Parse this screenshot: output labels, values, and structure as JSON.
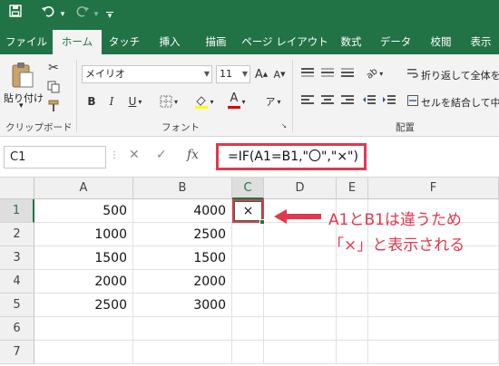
{
  "qat": {
    "redo_arrow": "▾",
    "customize": "▾"
  },
  "tabs": [
    "ファイル",
    "ホーム",
    "タッチ",
    "挿入",
    "描画",
    "ページ レイアウト",
    "数式",
    "データ",
    "校閲",
    "表示"
  ],
  "ribbon": {
    "clipboard": {
      "paste_label": "貼り付け",
      "paste_arrow": "▾",
      "group_label": "クリップボード"
    },
    "font": {
      "font_name": "メイリオ",
      "font_size": "11",
      "grow": "A",
      "shrink": "A",
      "bold": "B",
      "italic": "I",
      "underline": "U",
      "underline_arrow": "▾",
      "font_color": "A",
      "phonetic": "ア",
      "group_label": "フォント"
    },
    "alignment": {
      "wrap_text": "折り返して全体を",
      "merge_center": "セルを結合して中央",
      "group_label": "配置"
    }
  },
  "formula_bar": {
    "name_box": "C1",
    "cancel": "✕",
    "enter": "✓",
    "fx": "fx",
    "formula": "=IF(A1=B1,\"〇\",\"×\")"
  },
  "sheet": {
    "columns": [
      "A",
      "B",
      "C",
      "D",
      "E",
      "F"
    ],
    "rows": [
      {
        "num": "1",
        "a": "500",
        "b": "4000",
        "c": "×"
      },
      {
        "num": "2",
        "a": "1000",
        "b": "2500",
        "c": ""
      },
      {
        "num": "3",
        "a": "1500",
        "b": "1500",
        "c": ""
      },
      {
        "num": "4",
        "a": "2000",
        "b": "2000",
        "c": ""
      },
      {
        "num": "5",
        "a": "2500",
        "b": "3000",
        "c": ""
      },
      {
        "num": "6",
        "a": "",
        "b": "",
        "c": ""
      },
      {
        "num": "7",
        "a": "",
        "b": "",
        "c": ""
      }
    ]
  },
  "annotation": {
    "line1": "A1とB1は違うため",
    "line2": "「×」と表示される",
    "color": "#e0384f"
  }
}
